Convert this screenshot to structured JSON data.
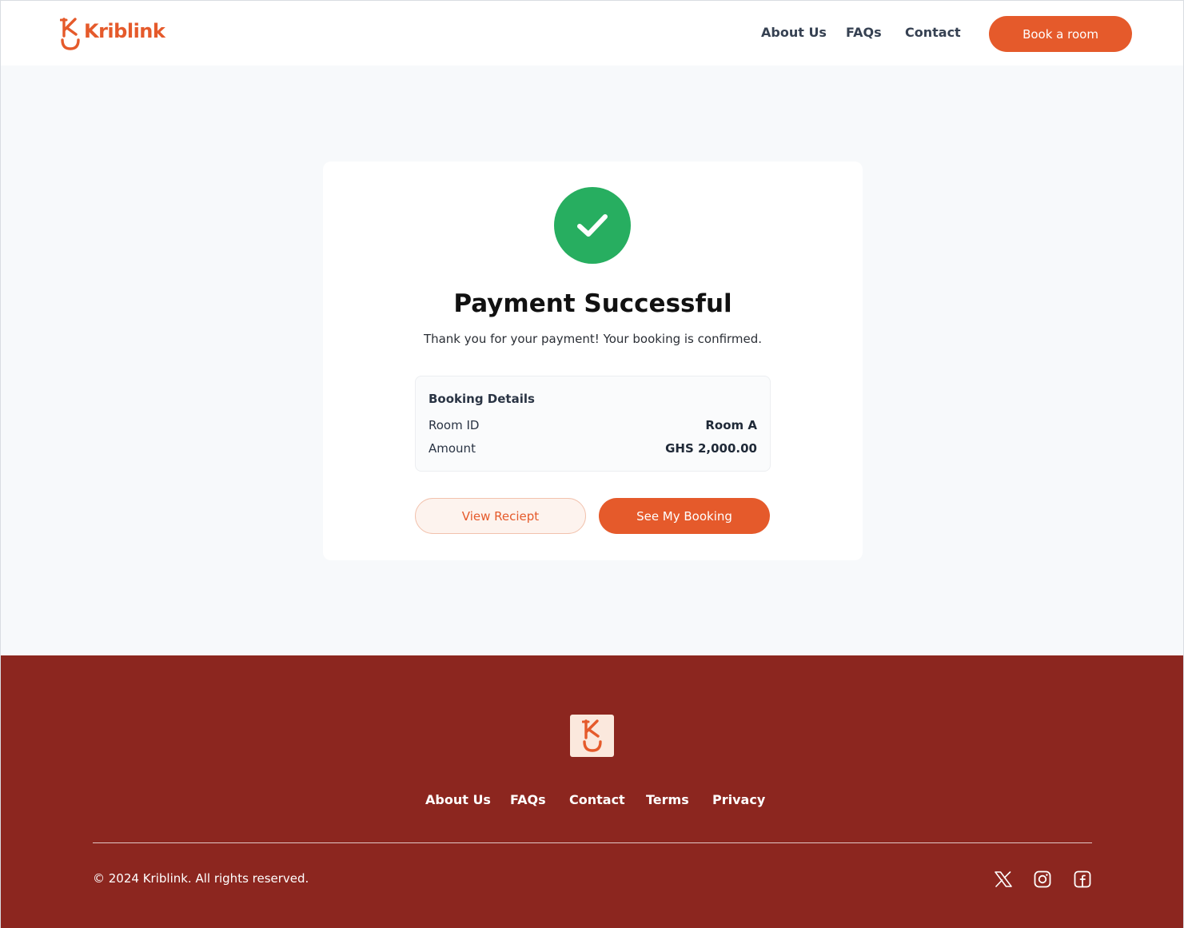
{
  "brand": {
    "name": "Kriblink",
    "accent_color": "#e55a2b",
    "success_color": "#27ae60",
    "footer_color": "#8c261f"
  },
  "header": {
    "nav": [
      "About Us",
      "FAQs",
      "Contact"
    ],
    "cta_label": "Book a room"
  },
  "confirmation": {
    "icon": "check-circle-icon",
    "title": "Payment Successful",
    "message": "Thank you for your payment! Your booking is confirmed.",
    "details": {
      "heading": "Booking Details",
      "rows": [
        {
          "label": "Room ID",
          "value": "Room A"
        },
        {
          "label": "Amount",
          "value": "GHS 2,000.00"
        }
      ]
    },
    "secondary_button": "View Reciept",
    "primary_button": "See My Booking"
  },
  "footer": {
    "links": [
      "About Us",
      "FAQs",
      "Contact",
      "Terms",
      "Privacy"
    ],
    "copyright": "© 2024 Kriblink. All rights reserved.",
    "social_icons": [
      "x-icon",
      "instagram-icon",
      "facebook-icon"
    ]
  }
}
